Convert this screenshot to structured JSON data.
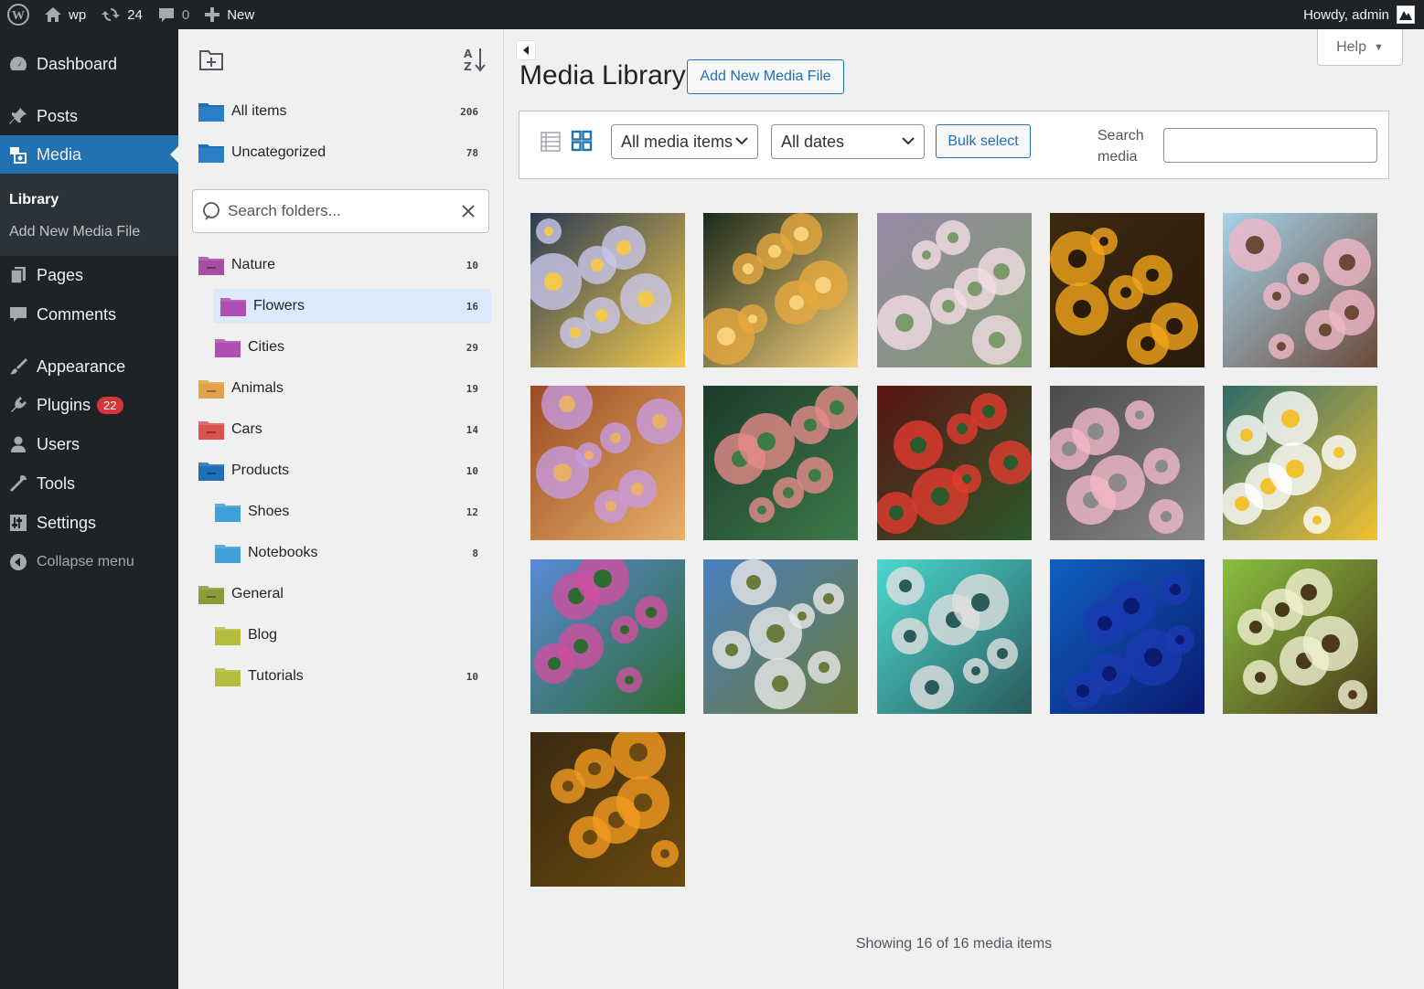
{
  "adminbar": {
    "site_name": "wp",
    "updates_count": "24",
    "comments_count": "0",
    "new_label": "New",
    "howdy": "Howdy, admin"
  },
  "menu": {
    "dashboard": "Dashboard",
    "posts": "Posts",
    "media": "Media",
    "library": "Library",
    "add_new": "Add New Media File",
    "pages": "Pages",
    "comments": "Comments",
    "appearance": "Appearance",
    "plugins": "Plugins",
    "plugins_badge": "22",
    "users": "Users",
    "tools": "Tools",
    "settings": "Settings",
    "collapse": "Collapse menu"
  },
  "folders": {
    "search_placeholder": "Search folders...",
    "all_items": {
      "label": "All items",
      "count": "206",
      "color": "#1e6fb5"
    },
    "uncategorized": {
      "label": "Uncategorized",
      "count": "78",
      "color": "#1e6fb5"
    },
    "tree": [
      {
        "label": "Nature",
        "count": "10",
        "color": "#a84ca4",
        "level": 0
      },
      {
        "label": "Flowers",
        "count": "16",
        "color": "#b04fb3",
        "level": 1
      },
      {
        "label": "Cities",
        "count": "29",
        "color": "#b04fb3",
        "level": 1
      },
      {
        "label": "Animals",
        "count": "19",
        "color": "#e2a24a",
        "level": 0
      },
      {
        "label": "Cars",
        "count": "14",
        "color": "#d9534f",
        "level": 0
      },
      {
        "label": "Products",
        "count": "10",
        "color": "#1e6fb5",
        "level": 0
      },
      {
        "label": "Shoes",
        "count": "12",
        "color": "#3fa0d8",
        "level": 1
      },
      {
        "label": "Notebooks",
        "count": "8",
        "color": "#3fa0d8",
        "level": 1
      },
      {
        "label": "General",
        "count": "",
        "color": "#8c9a3a",
        "level": 0
      },
      {
        "label": "Blog",
        "count": "",
        "color": "#b6bd3e",
        "level": 1
      },
      {
        "label": "Tutorials",
        "count": "10",
        "color": "#b6bd3e",
        "level": 1
      }
    ]
  },
  "main": {
    "title": "Media Library",
    "add_new_button": "Add New Media File",
    "help": "Help",
    "filter_type": "All media items",
    "filter_date": "All dates",
    "bulk_select": "Bulk select",
    "search_label": "Search media",
    "showing": "Showing 16 of 16 media items"
  },
  "media_items": [
    {
      "name": "asters",
      "colors": [
        "#2b3b55",
        "#c9c7ea",
        "#f2c94c"
      ]
    },
    {
      "name": "yellow-tulips",
      "colors": [
        "#1b2a1d",
        "#e7a93f",
        "#f7d27a"
      ]
    },
    {
      "name": "apple-blossom",
      "colors": [
        "#9a8aa9",
        "#f4dde5",
        "#7b9a6a"
      ]
    },
    {
      "name": "sunflowers",
      "colors": [
        "#3a2a12",
        "#f3a51a",
        "#2a1a0a"
      ]
    },
    {
      "name": "cherry-blossom",
      "colors": [
        "#a5d3ea",
        "#f0b8c8",
        "#6b4a3a"
      ]
    },
    {
      "name": "crocus-hands",
      "colors": [
        "#9a4a20",
        "#c79be0",
        "#e8b06a"
      ]
    },
    {
      "name": "calla-lily",
      "colors": [
        "#1c3a2a",
        "#e58a8a",
        "#3d7a4a"
      ]
    },
    {
      "name": "red-begonias",
      "colors": [
        "#5a1414",
        "#e23b2e",
        "#2b5a2b"
      ]
    },
    {
      "name": "water-lily",
      "colors": [
        "#4a4a4a",
        "#f2b8c8",
        "#8a8a8a"
      ]
    },
    {
      "name": "daisy",
      "colors": [
        "#2e6a6a",
        "#ffffff",
        "#f2c230"
      ]
    },
    {
      "name": "flower-field",
      "colors": [
        "#5a8ad8",
        "#d04fa0",
        "#2e6a30"
      ]
    },
    {
      "name": "dandelion",
      "colors": [
        "#4a80c0",
        "#e8e8e8",
        "#6a7a3a"
      ]
    },
    {
      "name": "dew-drops",
      "colors": [
        "#4ad8d0",
        "#e0e0e0",
        "#2a5a5a"
      ]
    },
    {
      "name": "blue-rose",
      "colors": [
        "#1060c0",
        "#1a3ab0",
        "#0a1a70"
      ]
    },
    {
      "name": "green-meadow",
      "colors": [
        "#8ac040",
        "#f0f0d0",
        "#4a3a1a"
      ]
    },
    {
      "name": "orange-poppies",
      "colors": [
        "#3a2a10",
        "#f39a20",
        "#6a4a10"
      ]
    }
  ]
}
